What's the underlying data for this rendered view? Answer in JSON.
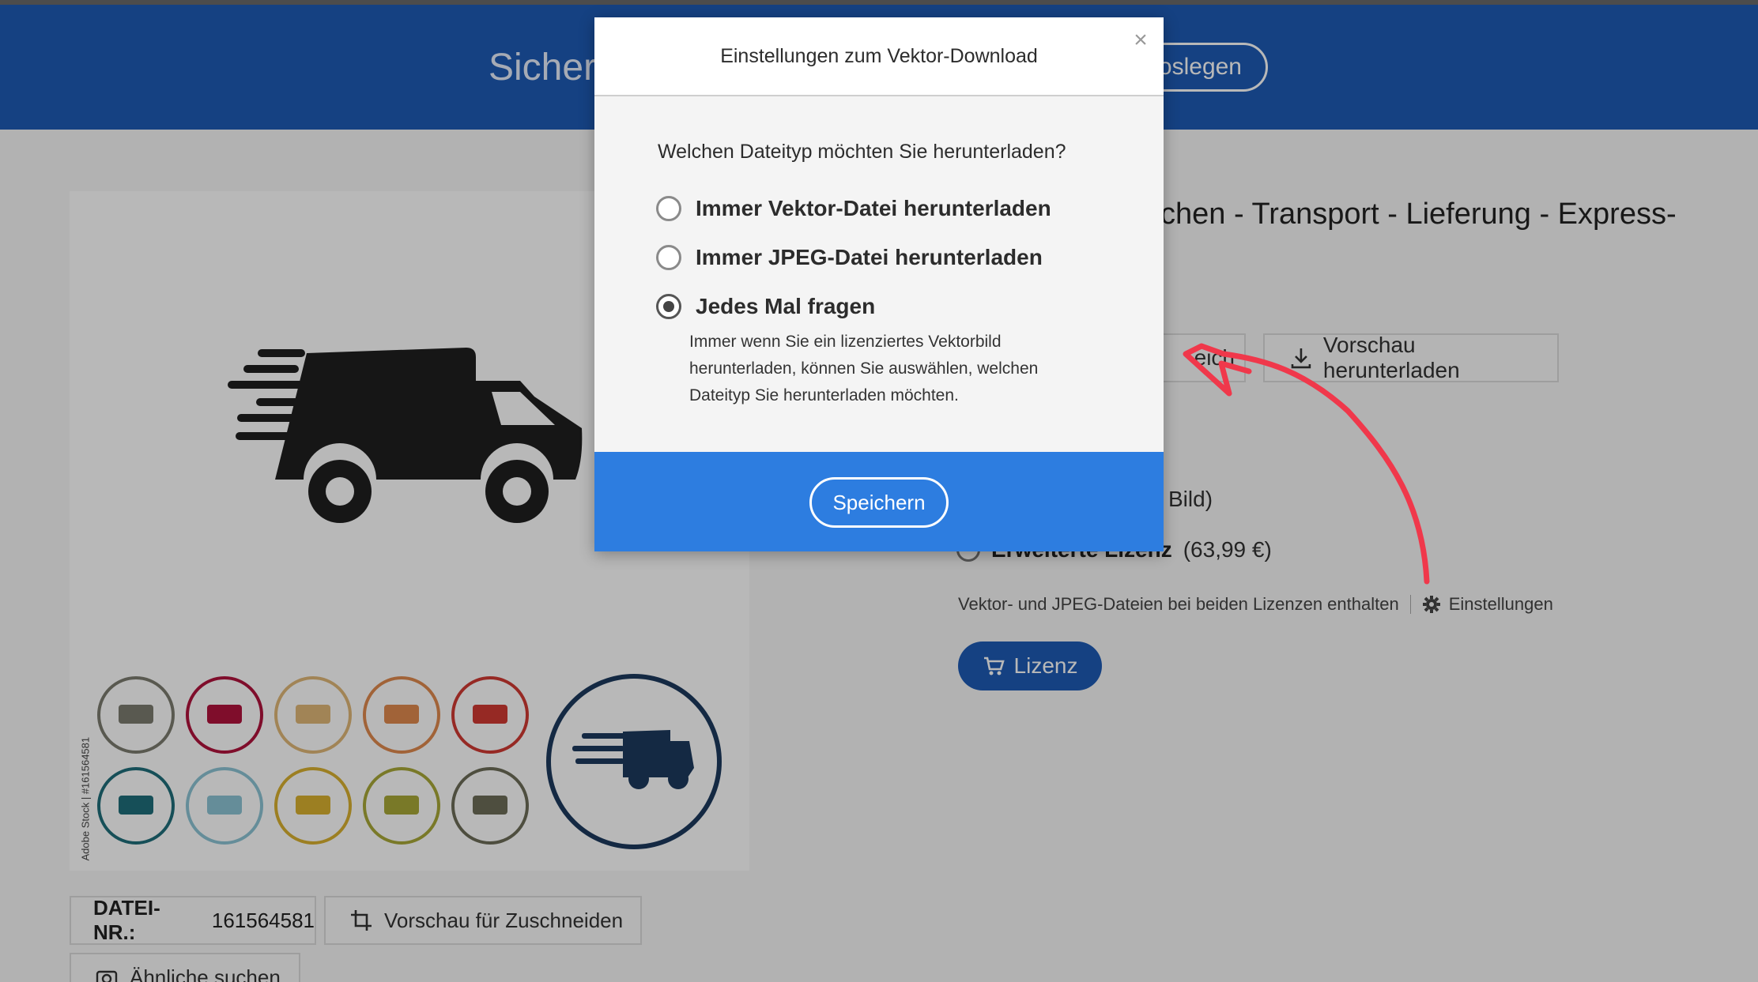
{
  "header": {
    "title_partial": "Sichern",
    "action_partial": "oslegen"
  },
  "asset": {
    "title_partial": "chen - Transport - Lieferung - Express-",
    "watermark": "Adobe Stock | #161564581",
    "file_label": "DATEI-NR.:",
    "file_number": "161564581",
    "crop_preview_label": "Vorschau für Zuschneiden",
    "similar_label": "Ähnliche suchen"
  },
  "actions": {
    "save_partial": "eich",
    "preview_download_label": "Vorschau herunterladen"
  },
  "license": {
    "standard_partial": "Bild)",
    "extended_name": "Erweiterte Lizenz",
    "extended_price": "(63,99 €)",
    "info_text": "Vektor- und JPEG-Dateien bei beiden Lizenzen enthalten",
    "settings_label": "Einstellungen",
    "license_button": "Lizenz"
  },
  "modal": {
    "title": "Einstellungen zum Vektor-Download",
    "close": "×",
    "question": "Welchen Dateityp möchten Sie herunterladen?",
    "options": [
      {
        "label": "Immer Vektor-Datei herunterladen",
        "selected": false
      },
      {
        "label": "Immer JPEG-Datei herunterladen",
        "selected": false
      },
      {
        "label": "Jedes Mal fragen",
        "selected": true
      }
    ],
    "option_description": "Immer wenn Sie ein lizenziertes Vektorbild herunterladen, können Sie auswählen, welchen Dateityp Sie herunterladen möchten.",
    "save_button": "Speichern"
  },
  "colors": {
    "header_blue": "#1e5bb5",
    "modal_footer_blue": "#2d7de0",
    "annotation_red": "#f0384b",
    "icon_circle_colors": [
      "#7c7c70",
      "#b0123c",
      "#e0b878",
      "#e08a4e",
      "#d03a32",
      "#1f6e7a",
      "#8cc4d4",
      "#d8b030",
      "#a8a838",
      "#6c6c58"
    ],
    "big_icon_circle": "#1c3a5e"
  }
}
